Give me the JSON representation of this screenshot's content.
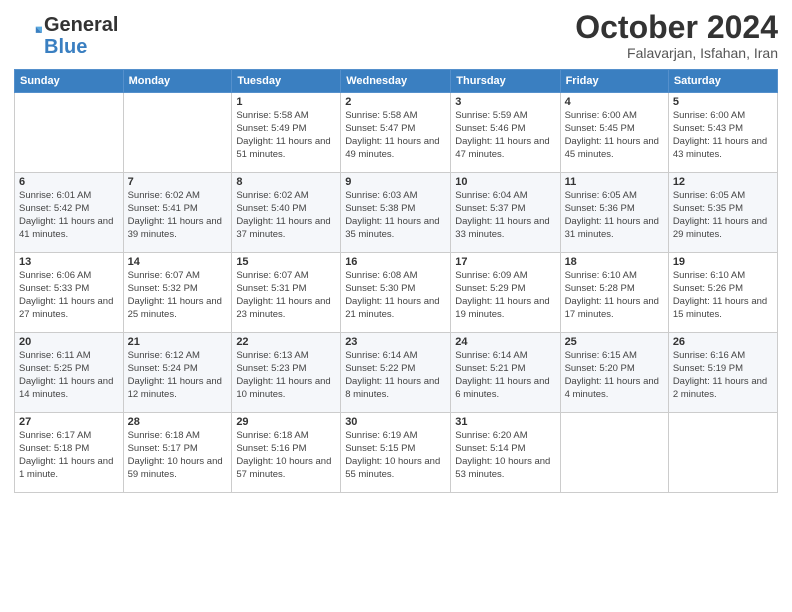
{
  "logo": {
    "general": "General",
    "blue": "Blue"
  },
  "header": {
    "month": "October 2024",
    "location": "Falavarjan, Isfahan, Iran"
  },
  "weekdays": [
    "Sunday",
    "Monday",
    "Tuesday",
    "Wednesday",
    "Thursday",
    "Friday",
    "Saturday"
  ],
  "weeks": [
    [
      {
        "day": "",
        "info": ""
      },
      {
        "day": "",
        "info": ""
      },
      {
        "day": "1",
        "info": "Sunrise: 5:58 AM\nSunset: 5:49 PM\nDaylight: 11 hours and 51 minutes."
      },
      {
        "day": "2",
        "info": "Sunrise: 5:58 AM\nSunset: 5:47 PM\nDaylight: 11 hours and 49 minutes."
      },
      {
        "day": "3",
        "info": "Sunrise: 5:59 AM\nSunset: 5:46 PM\nDaylight: 11 hours and 47 minutes."
      },
      {
        "day": "4",
        "info": "Sunrise: 6:00 AM\nSunset: 5:45 PM\nDaylight: 11 hours and 45 minutes."
      },
      {
        "day": "5",
        "info": "Sunrise: 6:00 AM\nSunset: 5:43 PM\nDaylight: 11 hours and 43 minutes."
      }
    ],
    [
      {
        "day": "6",
        "info": "Sunrise: 6:01 AM\nSunset: 5:42 PM\nDaylight: 11 hours and 41 minutes."
      },
      {
        "day": "7",
        "info": "Sunrise: 6:02 AM\nSunset: 5:41 PM\nDaylight: 11 hours and 39 minutes."
      },
      {
        "day": "8",
        "info": "Sunrise: 6:02 AM\nSunset: 5:40 PM\nDaylight: 11 hours and 37 minutes."
      },
      {
        "day": "9",
        "info": "Sunrise: 6:03 AM\nSunset: 5:38 PM\nDaylight: 11 hours and 35 minutes."
      },
      {
        "day": "10",
        "info": "Sunrise: 6:04 AM\nSunset: 5:37 PM\nDaylight: 11 hours and 33 minutes."
      },
      {
        "day": "11",
        "info": "Sunrise: 6:05 AM\nSunset: 5:36 PM\nDaylight: 11 hours and 31 minutes."
      },
      {
        "day": "12",
        "info": "Sunrise: 6:05 AM\nSunset: 5:35 PM\nDaylight: 11 hours and 29 minutes."
      }
    ],
    [
      {
        "day": "13",
        "info": "Sunrise: 6:06 AM\nSunset: 5:33 PM\nDaylight: 11 hours and 27 minutes."
      },
      {
        "day": "14",
        "info": "Sunrise: 6:07 AM\nSunset: 5:32 PM\nDaylight: 11 hours and 25 minutes."
      },
      {
        "day": "15",
        "info": "Sunrise: 6:07 AM\nSunset: 5:31 PM\nDaylight: 11 hours and 23 minutes."
      },
      {
        "day": "16",
        "info": "Sunrise: 6:08 AM\nSunset: 5:30 PM\nDaylight: 11 hours and 21 minutes."
      },
      {
        "day": "17",
        "info": "Sunrise: 6:09 AM\nSunset: 5:29 PM\nDaylight: 11 hours and 19 minutes."
      },
      {
        "day": "18",
        "info": "Sunrise: 6:10 AM\nSunset: 5:28 PM\nDaylight: 11 hours and 17 minutes."
      },
      {
        "day": "19",
        "info": "Sunrise: 6:10 AM\nSunset: 5:26 PM\nDaylight: 11 hours and 15 minutes."
      }
    ],
    [
      {
        "day": "20",
        "info": "Sunrise: 6:11 AM\nSunset: 5:25 PM\nDaylight: 11 hours and 14 minutes."
      },
      {
        "day": "21",
        "info": "Sunrise: 6:12 AM\nSunset: 5:24 PM\nDaylight: 11 hours and 12 minutes."
      },
      {
        "day": "22",
        "info": "Sunrise: 6:13 AM\nSunset: 5:23 PM\nDaylight: 11 hours and 10 minutes."
      },
      {
        "day": "23",
        "info": "Sunrise: 6:14 AM\nSunset: 5:22 PM\nDaylight: 11 hours and 8 minutes."
      },
      {
        "day": "24",
        "info": "Sunrise: 6:14 AM\nSunset: 5:21 PM\nDaylight: 11 hours and 6 minutes."
      },
      {
        "day": "25",
        "info": "Sunrise: 6:15 AM\nSunset: 5:20 PM\nDaylight: 11 hours and 4 minutes."
      },
      {
        "day": "26",
        "info": "Sunrise: 6:16 AM\nSunset: 5:19 PM\nDaylight: 11 hours and 2 minutes."
      }
    ],
    [
      {
        "day": "27",
        "info": "Sunrise: 6:17 AM\nSunset: 5:18 PM\nDaylight: 11 hours and 1 minute."
      },
      {
        "day": "28",
        "info": "Sunrise: 6:18 AM\nSunset: 5:17 PM\nDaylight: 10 hours and 59 minutes."
      },
      {
        "day": "29",
        "info": "Sunrise: 6:18 AM\nSunset: 5:16 PM\nDaylight: 10 hours and 57 minutes."
      },
      {
        "day": "30",
        "info": "Sunrise: 6:19 AM\nSunset: 5:15 PM\nDaylight: 10 hours and 55 minutes."
      },
      {
        "day": "31",
        "info": "Sunrise: 6:20 AM\nSunset: 5:14 PM\nDaylight: 10 hours and 53 minutes."
      },
      {
        "day": "",
        "info": ""
      },
      {
        "day": "",
        "info": ""
      }
    ]
  ]
}
